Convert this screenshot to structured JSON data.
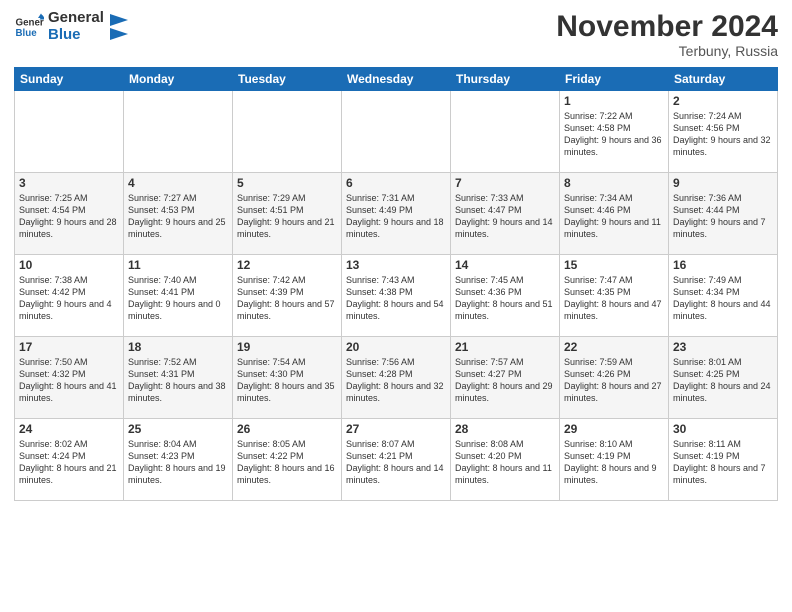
{
  "header": {
    "logo_line1": "General",
    "logo_line2": "Blue",
    "month": "November 2024",
    "location": "Terbuny, Russia"
  },
  "days_of_week": [
    "Sunday",
    "Monday",
    "Tuesday",
    "Wednesday",
    "Thursday",
    "Friday",
    "Saturday"
  ],
  "weeks": [
    [
      {
        "day": "",
        "info": ""
      },
      {
        "day": "",
        "info": ""
      },
      {
        "day": "",
        "info": ""
      },
      {
        "day": "",
        "info": ""
      },
      {
        "day": "",
        "info": ""
      },
      {
        "day": "1",
        "info": "Sunrise: 7:22 AM\nSunset: 4:58 PM\nDaylight: 9 hours and 36 minutes."
      },
      {
        "day": "2",
        "info": "Sunrise: 7:24 AM\nSunset: 4:56 PM\nDaylight: 9 hours and 32 minutes."
      }
    ],
    [
      {
        "day": "3",
        "info": "Sunrise: 7:25 AM\nSunset: 4:54 PM\nDaylight: 9 hours and 28 minutes."
      },
      {
        "day": "4",
        "info": "Sunrise: 7:27 AM\nSunset: 4:53 PM\nDaylight: 9 hours and 25 minutes."
      },
      {
        "day": "5",
        "info": "Sunrise: 7:29 AM\nSunset: 4:51 PM\nDaylight: 9 hours and 21 minutes."
      },
      {
        "day": "6",
        "info": "Sunrise: 7:31 AM\nSunset: 4:49 PM\nDaylight: 9 hours and 18 minutes."
      },
      {
        "day": "7",
        "info": "Sunrise: 7:33 AM\nSunset: 4:47 PM\nDaylight: 9 hours and 14 minutes."
      },
      {
        "day": "8",
        "info": "Sunrise: 7:34 AM\nSunset: 4:46 PM\nDaylight: 9 hours and 11 minutes."
      },
      {
        "day": "9",
        "info": "Sunrise: 7:36 AM\nSunset: 4:44 PM\nDaylight: 9 hours and 7 minutes."
      }
    ],
    [
      {
        "day": "10",
        "info": "Sunrise: 7:38 AM\nSunset: 4:42 PM\nDaylight: 9 hours and 4 minutes."
      },
      {
        "day": "11",
        "info": "Sunrise: 7:40 AM\nSunset: 4:41 PM\nDaylight: 9 hours and 0 minutes."
      },
      {
        "day": "12",
        "info": "Sunrise: 7:42 AM\nSunset: 4:39 PM\nDaylight: 8 hours and 57 minutes."
      },
      {
        "day": "13",
        "info": "Sunrise: 7:43 AM\nSunset: 4:38 PM\nDaylight: 8 hours and 54 minutes."
      },
      {
        "day": "14",
        "info": "Sunrise: 7:45 AM\nSunset: 4:36 PM\nDaylight: 8 hours and 51 minutes."
      },
      {
        "day": "15",
        "info": "Sunrise: 7:47 AM\nSunset: 4:35 PM\nDaylight: 8 hours and 47 minutes."
      },
      {
        "day": "16",
        "info": "Sunrise: 7:49 AM\nSunset: 4:34 PM\nDaylight: 8 hours and 44 minutes."
      }
    ],
    [
      {
        "day": "17",
        "info": "Sunrise: 7:50 AM\nSunset: 4:32 PM\nDaylight: 8 hours and 41 minutes."
      },
      {
        "day": "18",
        "info": "Sunrise: 7:52 AM\nSunset: 4:31 PM\nDaylight: 8 hours and 38 minutes."
      },
      {
        "day": "19",
        "info": "Sunrise: 7:54 AM\nSunset: 4:30 PM\nDaylight: 8 hours and 35 minutes."
      },
      {
        "day": "20",
        "info": "Sunrise: 7:56 AM\nSunset: 4:28 PM\nDaylight: 8 hours and 32 minutes."
      },
      {
        "day": "21",
        "info": "Sunrise: 7:57 AM\nSunset: 4:27 PM\nDaylight: 8 hours and 29 minutes."
      },
      {
        "day": "22",
        "info": "Sunrise: 7:59 AM\nSunset: 4:26 PM\nDaylight: 8 hours and 27 minutes."
      },
      {
        "day": "23",
        "info": "Sunrise: 8:01 AM\nSunset: 4:25 PM\nDaylight: 8 hours and 24 minutes."
      }
    ],
    [
      {
        "day": "24",
        "info": "Sunrise: 8:02 AM\nSunset: 4:24 PM\nDaylight: 8 hours and 21 minutes."
      },
      {
        "day": "25",
        "info": "Sunrise: 8:04 AM\nSunset: 4:23 PM\nDaylight: 8 hours and 19 minutes."
      },
      {
        "day": "26",
        "info": "Sunrise: 8:05 AM\nSunset: 4:22 PM\nDaylight: 8 hours and 16 minutes."
      },
      {
        "day": "27",
        "info": "Sunrise: 8:07 AM\nSunset: 4:21 PM\nDaylight: 8 hours and 14 minutes."
      },
      {
        "day": "28",
        "info": "Sunrise: 8:08 AM\nSunset: 4:20 PM\nDaylight: 8 hours and 11 minutes."
      },
      {
        "day": "29",
        "info": "Sunrise: 8:10 AM\nSunset: 4:19 PM\nDaylight: 8 hours and 9 minutes."
      },
      {
        "day": "30",
        "info": "Sunrise: 8:11 AM\nSunset: 4:19 PM\nDaylight: 8 hours and 7 minutes."
      }
    ]
  ]
}
